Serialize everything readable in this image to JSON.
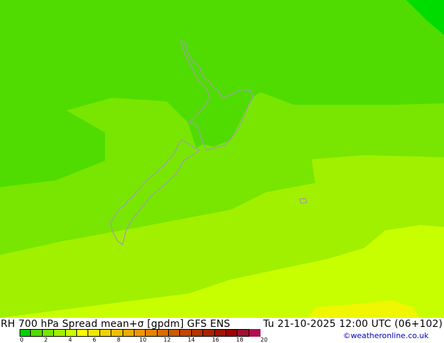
{
  "title_left": "RH 700 hPa Spread mean+σ [gpdm] GFS ENS",
  "title_right": "Tu 21-10-2025 12:00 UTC (06+102)",
  "credit": "©weatheronline.co.uk",
  "legend": {
    "colors": [
      "#00d000",
      "#50dc00",
      "#78e600",
      "#a0f000",
      "#c8ff00",
      "#ffff00",
      "#f0e600",
      "#f0d200",
      "#f0c000",
      "#f0aa00",
      "#f09600",
      "#e68200",
      "#d86e00",
      "#c85a00",
      "#c04800",
      "#b43600",
      "#a82400",
      "#a01400",
      "#9c0000",
      "#a01030",
      "#b01050"
    ],
    "ticks": [
      "0",
      "2",
      "4",
      "6",
      "8",
      "10",
      "12",
      "14",
      "16",
      "18",
      "20"
    ]
  },
  "map_colors": {
    "band0": "#00dc00",
    "band1": "#50dc00",
    "band2": "#78e600",
    "band3": "#a0f000",
    "band4": "#c8ff00",
    "band5": "#f0f500",
    "coast": "#a0a0a0"
  }
}
